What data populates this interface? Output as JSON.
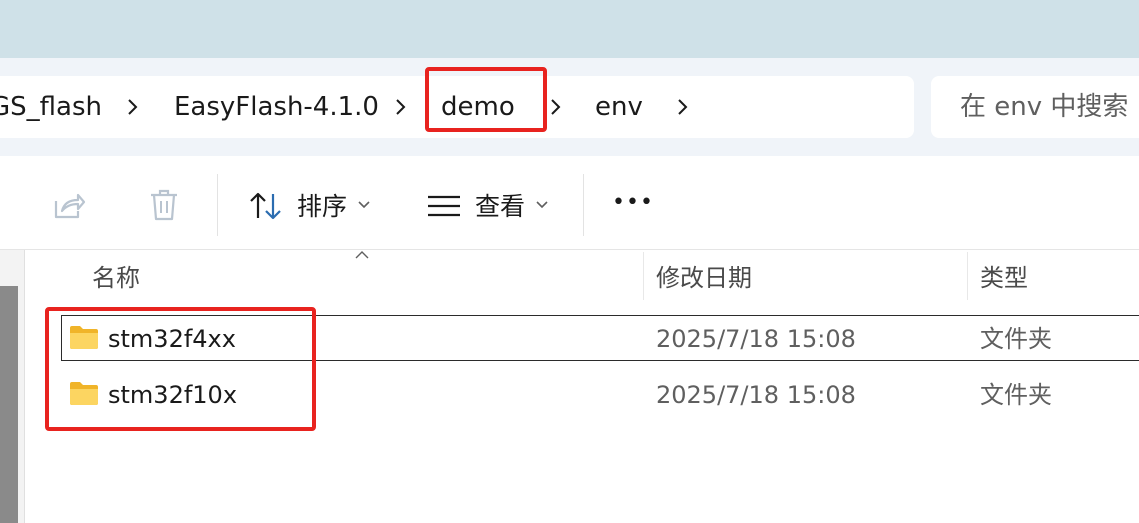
{
  "breadcrumb": {
    "items": [
      "GS_flash",
      "EasyFlash-4.1.0",
      "demo",
      "env"
    ]
  },
  "search": {
    "placeholder": "在 env 中搜索"
  },
  "toolbar": {
    "sort_label": "排序",
    "view_label": "查看",
    "more_label": "•••"
  },
  "columns": {
    "name": "名称",
    "modified": "修改日期",
    "type": "类型"
  },
  "files": [
    {
      "name": "stm32f4xx",
      "modified": "2025/7/18 15:08",
      "type": "文件夹"
    },
    {
      "name": "stm32f10x",
      "modified": "2025/7/18 15:08",
      "type": "文件夹"
    }
  ],
  "colors": {
    "titlebar": "#cfe1e8",
    "addressbar": "#f0f4f9",
    "highlight_red": "#e8231f",
    "folder_yellow": "#f7c948"
  },
  "icons": [
    "share-icon",
    "delete-icon",
    "sort-icon",
    "view-icon",
    "chevron-right-icon",
    "chevron-down-icon",
    "folder-icon"
  ]
}
